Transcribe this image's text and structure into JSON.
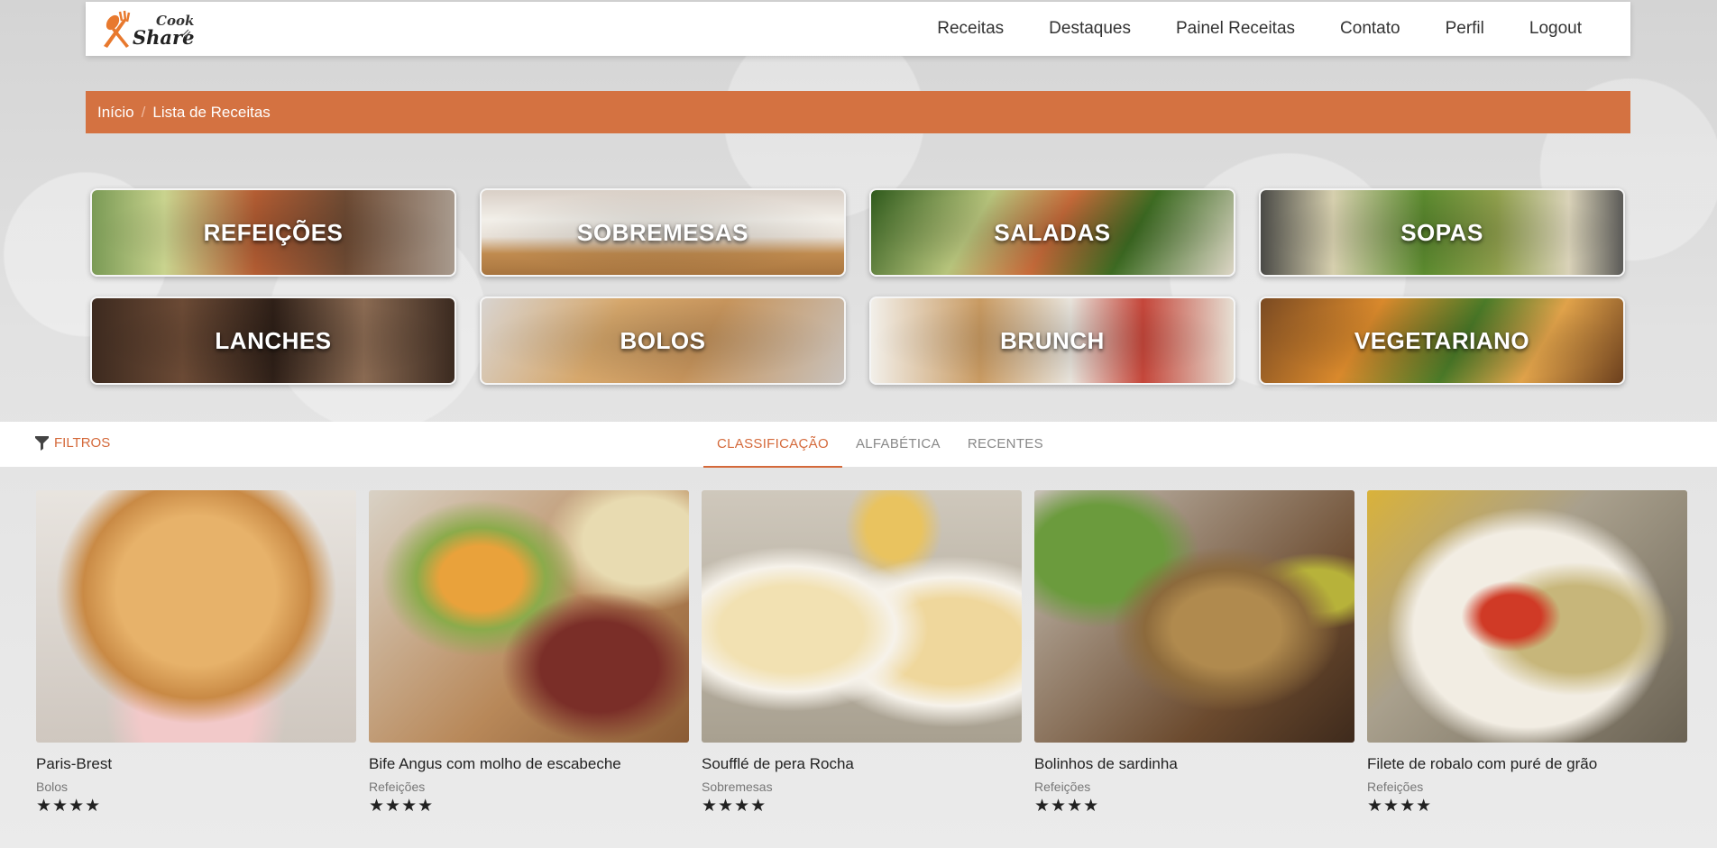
{
  "nav": {
    "logo_text_1": "Cook",
    "logo_text_2": "Share",
    "items": [
      {
        "label": "Receitas"
      },
      {
        "label": "Destaques"
      },
      {
        "label": "Painel Receitas"
      },
      {
        "label": "Contato"
      },
      {
        "label": "Perfil"
      },
      {
        "label": "Logout"
      }
    ]
  },
  "breadcrumb": {
    "home": "Início",
    "separator": "/",
    "current": "Lista de Receitas"
  },
  "categories": [
    {
      "label": "REFEIÇÕES"
    },
    {
      "label": "SOBREMESAS"
    },
    {
      "label": "SALADAS"
    },
    {
      "label": "SOPAS"
    },
    {
      "label": "LANCHES"
    },
    {
      "label": "BOLOS"
    },
    {
      "label": "BRUNCH"
    },
    {
      "label": "VEGETARIANO"
    }
  ],
  "filters": {
    "label": "FILTROS",
    "icon": "filter-icon"
  },
  "tabs": [
    {
      "label": "CLASSIFICAÇÃO",
      "active": true
    },
    {
      "label": "ALFABÉTICA",
      "active": false
    },
    {
      "label": "RECENTES",
      "active": false
    }
  ],
  "recipes": [
    {
      "title": "Paris-Brest",
      "category": "Bolos",
      "rating": 4
    },
    {
      "title": "Bife Angus com molho de escabeche",
      "category": "Refeições",
      "rating": 4
    },
    {
      "title": "Soufflé de pera Rocha",
      "category": "Sobremesas",
      "rating": 4
    },
    {
      "title": "Bolinhos de sardinha",
      "category": "Refeições",
      "rating": 4
    },
    {
      "title": "Filete de robalo com puré de grão",
      "category": "Refeições",
      "rating": 4
    }
  ],
  "colors": {
    "accent": "#d47241",
    "background": "#e6e6e6"
  }
}
